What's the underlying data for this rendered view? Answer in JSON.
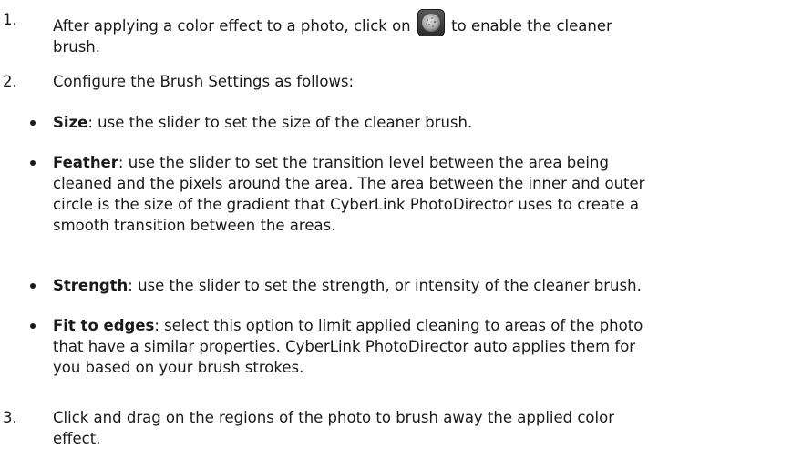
{
  "steps": [
    {
      "number": "1.",
      "text_before_icon": "After applying a color effect to a photo, click on ",
      "icon": "cleaner-brush-icon",
      "text_after_icon": " to enable the cleaner",
      "text_line2": "brush."
    },
    {
      "number": "2.",
      "text": "Configure the Brush Settings as follows:"
    },
    {
      "number": "3.",
      "text_line1": "Click and drag on the regions of the photo to brush away the applied color",
      "text_line2": "effect."
    }
  ],
  "settings": [
    {
      "term": "Size",
      "lines": [
        ": use the slider to set the size of the cleaner brush."
      ]
    },
    {
      "term": "Feather",
      "lines": [
        ": use the slider to set the transition level between the area being",
        "cleaned and the pixels around the area. The area between the inner and outer",
        "circle is the size of the gradient that CyberLink PhotoDirector uses to create a",
        "smooth transition between the areas."
      ]
    },
    {
      "term": "Strength",
      "lines": [
        ": use the slider to set the strength, or intensity of the cleaner brush."
      ]
    },
    {
      "term": "Fit to edges",
      "lines": [
        ": select this option to limit applied cleaning to areas of the photo",
        "that have a similar properties. CyberLink PhotoDirector auto applies them for",
        "you based on your brush strokes."
      ]
    }
  ]
}
